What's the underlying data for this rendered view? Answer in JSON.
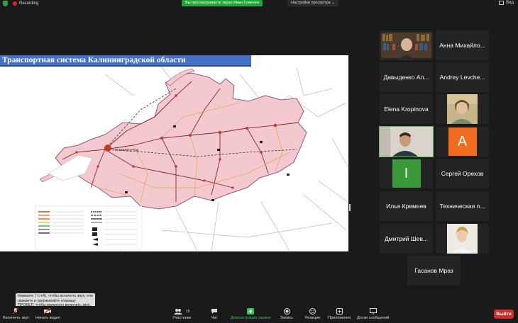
{
  "topbar": {
    "recording": "Recording",
    "viewing_banner": "Вы просматриваете экран Иван Гуменюк",
    "view_options": "Настройки просмотра",
    "view_mode": "Вид"
  },
  "slide": {
    "title": "Транспортная система Калининградской области"
  },
  "map": {
    "city_label": "КАЛИНИНГРАД",
    "colors": {
      "land": "#f3c8cf",
      "border": "#8a5a7a",
      "roads": "#7d2a2a",
      "sea": "#ffffff"
    }
  },
  "participants": [
    {
      "name": "",
      "type": "video-bookshelf"
    },
    {
      "name": "Анна Михайло..."
    },
    {
      "name": "Давыденко Ал..."
    },
    {
      "name": "Andrey Levche..."
    },
    {
      "name": "Elena Kropinova"
    },
    {
      "name": "",
      "type": "video-woman"
    },
    {
      "name": "",
      "type": "video-man",
      "active": true
    },
    {
      "name": "A",
      "type": "letter",
      "color": "#f26c1f"
    },
    {
      "name": "I",
      "type": "letter",
      "color": "#3a9a3a"
    },
    {
      "name": "Сергей Орехов"
    },
    {
      "name": "Илья Кремнев"
    },
    {
      "name": "Техническая п..."
    },
    {
      "name": "Дмитрий Шев..."
    },
    {
      "name": "",
      "type": "video-blonde"
    },
    {
      "name": "Гасанов Мраз"
    }
  ],
  "tooltip": "Нажмите (⌥+A), чтобы включить звук, или нажмите и удерживайте клавишу ПРОБЕЛ, чтобы временно включить звук.",
  "toolbar": {
    "unmute": "Включить звук",
    "start_video": "Начать видео",
    "participants": "Участники",
    "participants_count": "15",
    "chat": "Чат",
    "share": "Демонстрация экрана",
    "record": "Запись",
    "reactions": "Реакции",
    "apps": "Приложения",
    "whiteboards": "Доски сообщений",
    "leave": "Выйти"
  }
}
